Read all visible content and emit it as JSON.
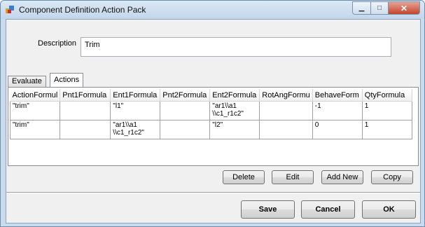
{
  "window": {
    "title": "Component Definition Action Pack"
  },
  "description": {
    "label": "Description",
    "value": "Trim"
  },
  "tabs": [
    {
      "label": "Evaluate If"
    },
    {
      "label": "Actions"
    }
  ],
  "grid": {
    "columns": [
      "ActionFormul",
      "Pnt1Formula",
      "Ent1Formula",
      "Pnt2Formula",
      "Ent2Formula",
      "RotAngFormu",
      "BehaveForm",
      "QtyFormula"
    ],
    "rows": [
      [
        "\"trim\"",
        "",
        "\"l1\"",
        "",
        "\"ar1\\\\a1\n\\\\c1_r1c2\"",
        "",
        "-1",
        "1"
      ],
      [
        "\"trim\"",
        "",
        "\"ar1\\\\a1\n\\\\c1_r1c2\"",
        "",
        "\"l2\"",
        "",
        "0",
        "1"
      ]
    ]
  },
  "buttons": {
    "delete": "Delete",
    "edit": "Edit",
    "add_new": "Add New",
    "copy": "Copy",
    "save": "Save",
    "cancel": "Cancel",
    "ok": "OK"
  }
}
